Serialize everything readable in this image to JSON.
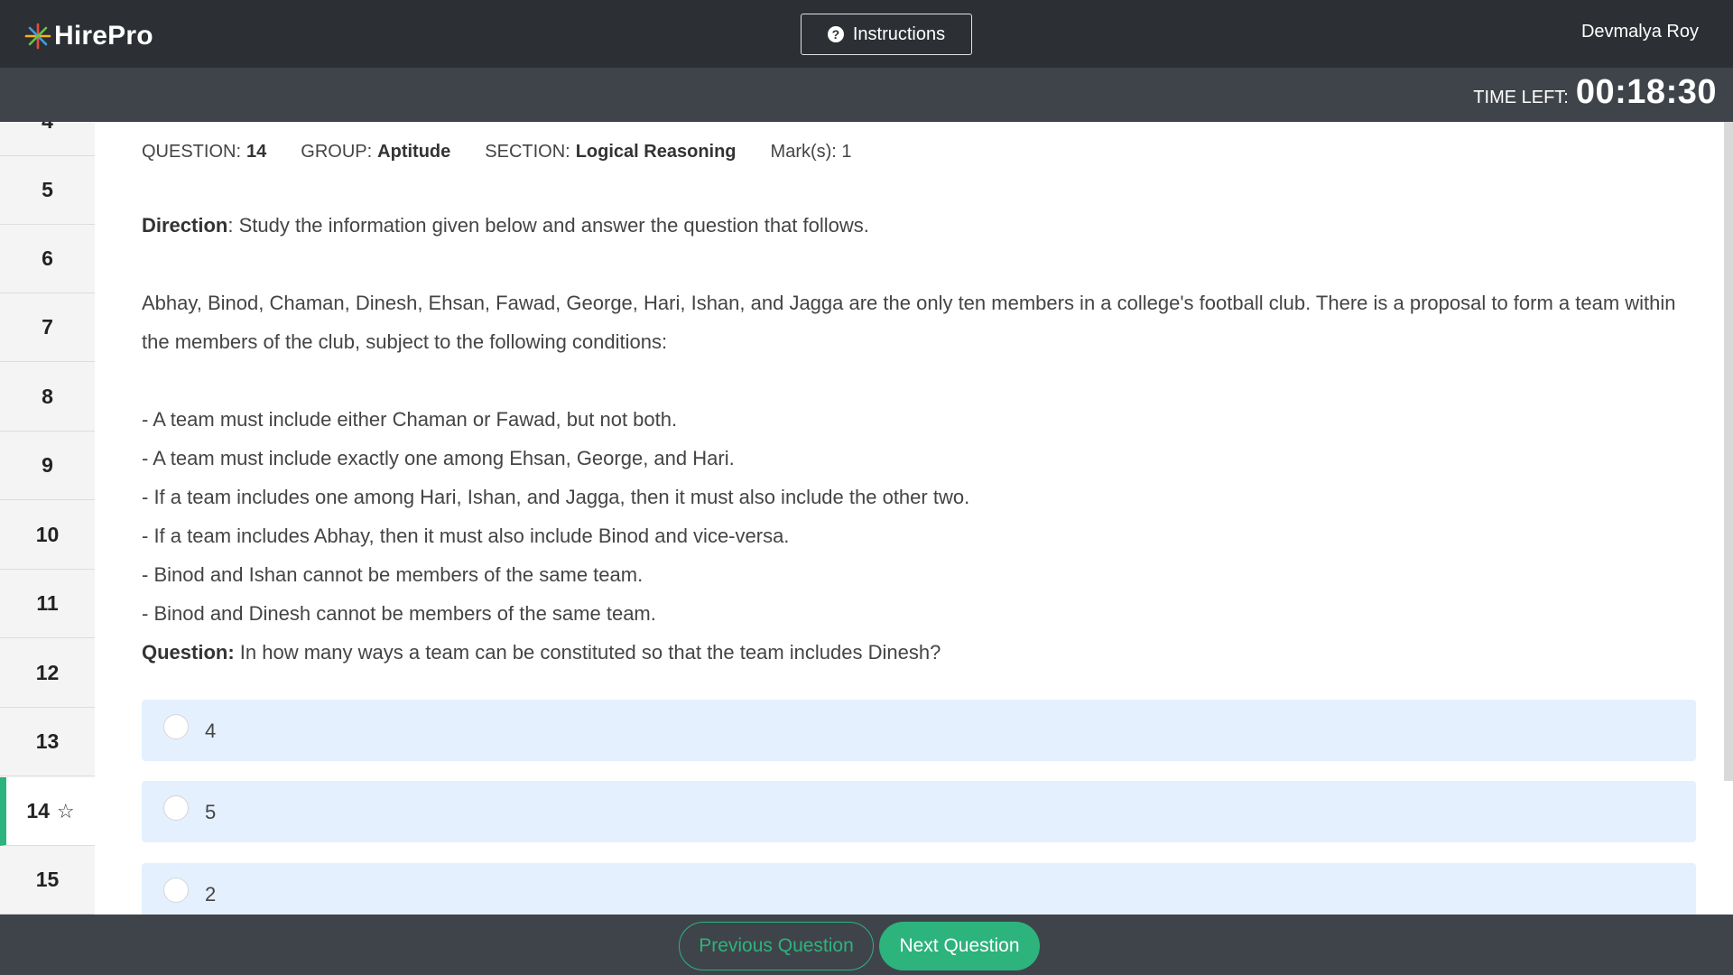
{
  "header": {
    "logo_text": "HirePro",
    "instructions_label": "Instructions",
    "user_name": "Devmalya Roy",
    "time_label": "TIME LEFT:",
    "time_value": "00:18:30"
  },
  "sidebar": {
    "items": [
      {
        "label": "4"
      },
      {
        "label": "5"
      },
      {
        "label": "6"
      },
      {
        "label": "7"
      },
      {
        "label": "8"
      },
      {
        "label": "9"
      },
      {
        "label": "10"
      },
      {
        "label": "11"
      },
      {
        "label": "12"
      },
      {
        "label": "13"
      },
      {
        "label": "14",
        "current": true
      },
      {
        "label": "15"
      }
    ]
  },
  "question_meta": {
    "question_label": "QUESTION:",
    "question_value": "14",
    "group_label": "GROUP:",
    "group_value": "Aptitude",
    "section_label": "SECTION:",
    "section_value": "Logical Reasoning",
    "marks_label": "Mark(s):",
    "marks_value": "1"
  },
  "question": {
    "direction_label": "Direction",
    "direction_text": ": Study the information given below and answer the question that follows.",
    "passage": "Abhay, Binod, Chaman, Dinesh, Ehsan, Fawad, George, Hari, Ishan, and Jagga are the only ten members in a college's football club. There is a proposal to form a team within the members of the club, subject to the following conditions:",
    "conditions": [
      "- A team must include either Chaman or Fawad, but not both.",
      "- A team must include exactly one among Ehsan, George, and Hari.",
      "- If a team includes one among Hari, Ishan, and Jagga, then it must also include the other two.",
      "- If a team includes Abhay, then it must also include Binod and vice-versa.",
      "- Binod and Ishan cannot be members of the same team.",
      "- Binod and Dinesh cannot be members of the same team."
    ],
    "question_label": "Question:",
    "question_text": " In how many ways a team can be constituted so that the team includes Dinesh?"
  },
  "options": [
    {
      "label": "4"
    },
    {
      "label": "5"
    },
    {
      "label": "2"
    }
  ],
  "footer": {
    "previous_label": "Previous Question",
    "next_label": "Next Question"
  },
  "colors": {
    "accent": "#2db37c",
    "header_bg": "#2c3034",
    "bar_bg": "#3f444a",
    "option_bg": "#e4f0fe"
  }
}
